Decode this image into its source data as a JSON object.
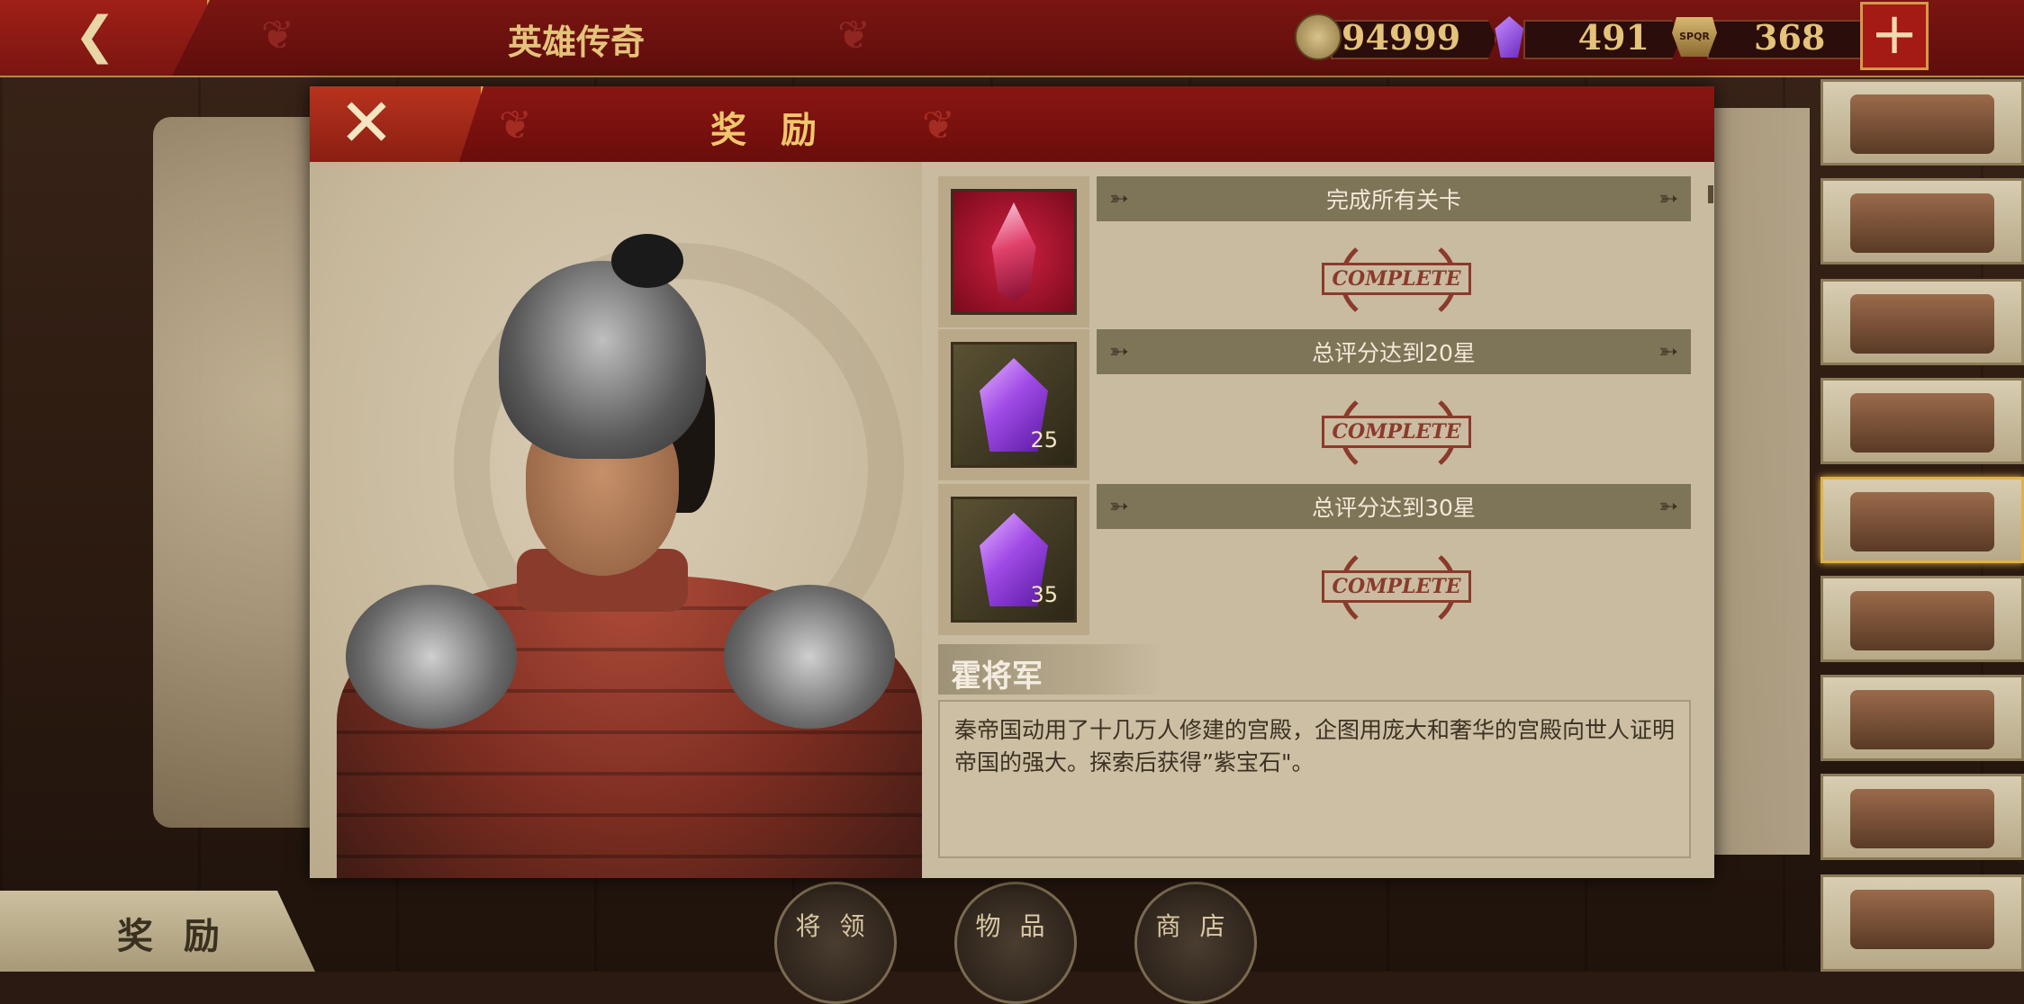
{
  "top_bar": {
    "title": "英雄传奇",
    "coins": "94999",
    "gems": "491",
    "honor": "368",
    "spqr_label": "SPQR"
  },
  "modal": {
    "title": "奖 励",
    "rewards": [
      {
        "item": "ruby-crystal",
        "quantity": "",
        "requirement": "完成所有关卡",
        "status": "COMPLETE"
      },
      {
        "item": "amethyst",
        "quantity": "25",
        "requirement": "总评分达到20星",
        "status": "COMPLETE"
      },
      {
        "item": "amethyst",
        "quantity": "35",
        "requirement": "总评分达到30星",
        "status": "COMPLETE"
      }
    ],
    "general_name": "霍将军",
    "description": "秦帝国动用了十几万人修建的宫殿，企图用庞大和奢华的宫殿向世人证明帝国的强大。探索后获得”紫宝石\"。"
  },
  "bottom": {
    "reward_tab": "奖 励",
    "nav": [
      "将 领",
      "物 品",
      "商 店"
    ]
  },
  "icons": {
    "back": "chevron-left-icon",
    "close": "close-icon",
    "plus": "plus-icon"
  },
  "colors": {
    "banner_red": "#7a1512",
    "gold_text": "#e4c37a",
    "parchment": "#c9bba0",
    "stamp_red": "#8a3a2c"
  }
}
